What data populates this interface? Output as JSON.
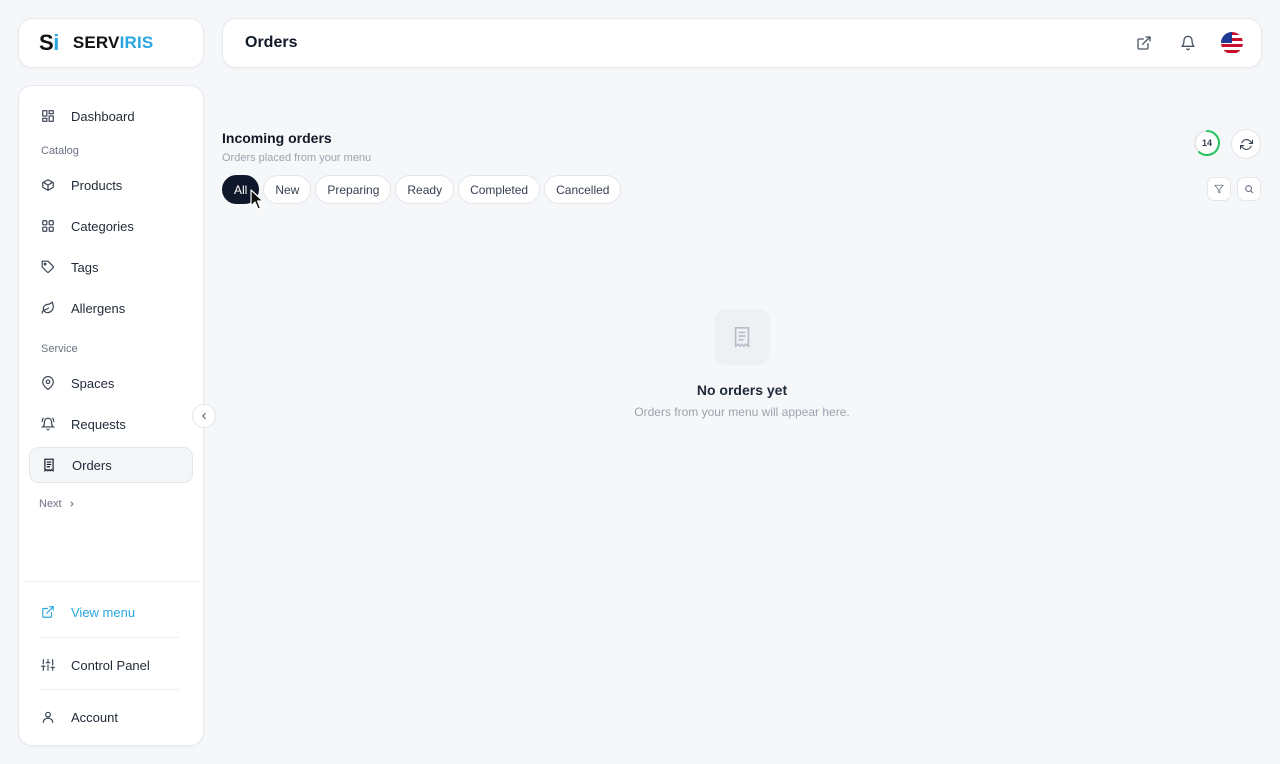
{
  "brand": {
    "mark": "Si",
    "name_part1": "SERV",
    "name_part2": "IRIS"
  },
  "header": {
    "title": "Orders"
  },
  "sidebar": {
    "items": [
      {
        "label": "Dashboard"
      },
      {
        "label": "Products"
      },
      {
        "label": "Categories"
      },
      {
        "label": "Tags"
      },
      {
        "label": "Allergens"
      },
      {
        "label": "Spaces"
      },
      {
        "label": "Requests"
      },
      {
        "label": "Orders"
      }
    ],
    "sections": {
      "catalog": "Catalog",
      "service": "Service"
    },
    "next": "Next",
    "footer": {
      "view_menu": "View menu",
      "control_panel": "Control Panel",
      "account": "Account"
    }
  },
  "main": {
    "title": "Incoming orders",
    "subtitle": "Orders placed from your menu",
    "tabs": [
      "All",
      "New",
      "Preparing",
      "Ready",
      "Completed",
      "Cancelled"
    ],
    "active_tab": "All",
    "counter": "14",
    "empty": {
      "title": "No orders yet",
      "subtitle": "Orders from your menu will appear here."
    }
  },
  "colors": {
    "accent": "#2aa7e0",
    "active_tab": "#0f172a",
    "counter_ring": "#22c55e"
  }
}
